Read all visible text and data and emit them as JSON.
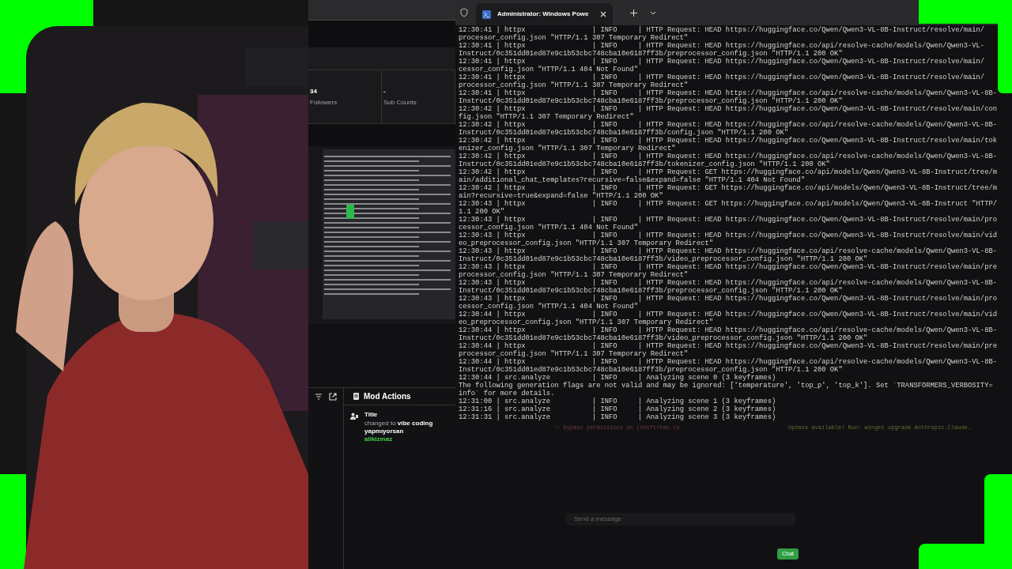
{
  "dashboard": {
    "stats": [
      {
        "value": "34",
        "label": "Followers"
      },
      {
        "value": "-",
        "label": "Sub Counts"
      }
    ],
    "mod_actions": {
      "title": "Mod Actions",
      "entries": [
        {
          "action": "Title",
          "detail": "changed to **vibe coding yapmıyorsan**",
          "user": "alikizmaz"
        }
      ]
    }
  },
  "terminal": {
    "tab": {
      "title": "Administrator: Windows Powe",
      "selected": true
    },
    "lines": [
      "12:30:41 | httpx                | INFO     | HTTP Request: HEAD https://huggingface.co/Qwen/Qwen3-VL-8B-Instruct/resolve/main/",
      "processor_config.json \"HTTP/1.1 307 Temporary Redirect\"",
      "12:30:41 | httpx                | INFO     | HTTP Request: HEAD https://huggingface.co/api/resolve-cache/models/Qwen/Qwen3-VL-",
      "Instruct/0c351dd01ed87e9c1b53cbc748cba10e6187ff3b/preprocessor_config.json \"HTTP/1.1 200 OK\"",
      "12:30:41 | httpx                | INFO     | HTTP Request: HEAD https://huggingface.co/Qwen/Qwen3-VL-8B-Instruct/resolve/main/",
      "cessor_config.json \"HTTP/1.1 404 Not Found\"",
      "12:30:41 | httpx                | INFO     | HTTP Request: HEAD https://huggingface.co/Qwen/Qwen3-VL-8B-Instruct/resolve/main/",
      "processor_config.json \"HTTP/1.1 307 Temporary Redirect\"",
      "12:30:41 | httpx                | INFO     | HTTP Request: HEAD https://huggingface.co/api/resolve-cache/models/Qwen/Qwen3-VL-8B-",
      "Instruct/0c351dd01ed87e9c1b53cbc748cba10e6187ff3b/preprocessor_config.json \"HTTP/1.1 200 OK\"",
      "12:30:42 | httpx                | INFO     | HTTP Request: HEAD https://huggingface.co/Qwen/Qwen3-VL-8B-Instruct/resolve/main/con",
      "fig.json \"HTTP/1.1 307 Temporary Redirect\"",
      "12:30:42 | httpx                | INFO     | HTTP Request: HEAD https://huggingface.co/api/resolve-cache/models/Qwen/Qwen3-VL-8B-",
      "Instruct/0c351dd01ed87e9c1b53cbc748cba10e6187ff3b/config.json \"HTTP/1.1 200 OK\"",
      "12:30:42 | httpx                | INFO     | HTTP Request: HEAD https://huggingface.co/Qwen/Qwen3-VL-8B-Instruct/resolve/main/tok",
      "enizer_config.json \"HTTP/1.1 307 Temporary Redirect\"",
      "12:30:42 | httpx                | INFO     | HTTP Request: HEAD https://huggingface.co/api/resolve-cache/models/Qwen/Qwen3-VL-8B-",
      "Instruct/0c351dd01ed87e9c1b53cbc748cba10e6187ff3b/tokenizer_config.json \"HTTP/1.1 200 OK\"",
      "12:30:42 | httpx                | INFO     | HTTP Request: GET https://huggingface.co/api/models/Qwen/Qwen3-VL-8B-Instruct/tree/m",
      "ain/additional_chat_templates?recursive=false&expand=false \"HTTP/1.1 404 Not Found\"",
      "12:30:42 | httpx                | INFO     | HTTP Request: GET https://huggingface.co/api/models/Qwen/Qwen3-VL-8B-Instruct/tree/m",
      "ain?recursive=true&expand=false \"HTTP/1.1 200 OK\"",
      "12:30:43 | httpx                | INFO     | HTTP Request: GET https://huggingface.co/api/models/Qwen/Qwen3-VL-8B-Instruct \"HTTP/",
      "1.1 200 OK\"",
      "12:30:43 | httpx                | INFO     | HTTP Request: HEAD https://huggingface.co/Qwen/Qwen3-VL-8B-Instruct/resolve/main/pro",
      "cessor_config.json \"HTTP/1.1 404 Not Found\"",
      "12:30:43 | httpx                | INFO     | HTTP Request: HEAD https://huggingface.co/Qwen/Qwen3-VL-8B-Instruct/resolve/main/vid",
      "eo_preprocessor_config.json \"HTTP/1.1 307 Temporary Redirect\"",
      "12:30:43 | httpx                | INFO     | HTTP Request: HEAD https://huggingface.co/api/resolve-cache/models/Qwen/Qwen3-VL-8B-",
      "Instruct/0c351dd01ed87e9c1b53cbc748cba10e6187ff3b/video_preprocessor_config.json \"HTTP/1.1 200 OK\"",
      "12:30:43 | httpx                | INFO     | HTTP Request: HEAD https://huggingface.co/Qwen/Qwen3-VL-8B-Instruct/resolve/main/pre",
      "processor_config.json \"HTTP/1.1 307 Temporary Redirect\"",
      "12:30:43 | httpx                | INFO     | HTTP Request: HEAD https://huggingface.co/api/resolve-cache/models/Qwen/Qwen3-VL-8B-",
      "Instruct/0c351dd01ed87e9c1b53cbc748cba10e6187ff3b/preprocessor_config.json \"HTTP/1.1 200 OK\"",
      "12:30:43 | httpx                | INFO     | HTTP Request: HEAD https://huggingface.co/Qwen/Qwen3-VL-8B-Instruct/resolve/main/pro",
      "cessor_config.json \"HTTP/1.1 404 Not Found\"",
      "12:30:44 | httpx                | INFO     | HTTP Request: HEAD https://huggingface.co/Qwen/Qwen3-VL-8B-Instruct/resolve/main/vid",
      "eo_preprocessor_config.json \"HTTP/1.1 307 Temporary Redirect\"",
      "12:30:44 | httpx                | INFO     | HTTP Request: HEAD https://huggingface.co/api/resolve-cache/models/Qwen/Qwen3-VL-8B-",
      "Instruct/0c351dd01ed87e9c1b53cbc748cba10e6187ff3b/video_preprocessor_config.json \"HTTP/1.1 200 OK\"",
      "12:30:44 | httpx                | INFO     | HTTP Request: HEAD https://huggingface.co/Qwen/Qwen3-VL-8B-Instruct/resolve/main/pre",
      "processor_config.json \"HTTP/1.1 307 Temporary Redirect\"",
      "12:30:44 | httpx                | INFO     | HTTP Request: HEAD https://huggingface.co/api/resolve-cache/models/Qwen/Qwen3-VL-8B-",
      "Instruct/0c351dd01ed87e9c1b53cbc748cba10e6187ff3b/preprocessor_config.json \"HTTP/1.1 200 OK\"",
      "12:30:44 | src.analyze          | INFO     | Analyzing scene 0 (3 keyframes)",
      "The following generation flags are not valid and may be ignored: ['temperature', 'top_p', 'top_k']. Set `TRANSFORMERS_VERBOSITY=",
      "info` for more details.",
      "12:31:00 | src.analyze          | INFO     | Analyzing scene 1 (3 keyframes)",
      "12:31:16 | src.analyze          | INFO     | Analyzing scene 2 (3 keyframes)",
      "12:31:31 | src.analyze          | INFO     | Analyzing scene 3 (3 keyframes)"
    ],
    "status": {
      "left": "›› bypass permissions on (shift+tab to",
      "right": "Update available! Run: winget upgrade Anthropic.Claude…"
    }
  },
  "chat": {
    "placeholder": "Send a message",
    "send_button": "Chat"
  }
}
